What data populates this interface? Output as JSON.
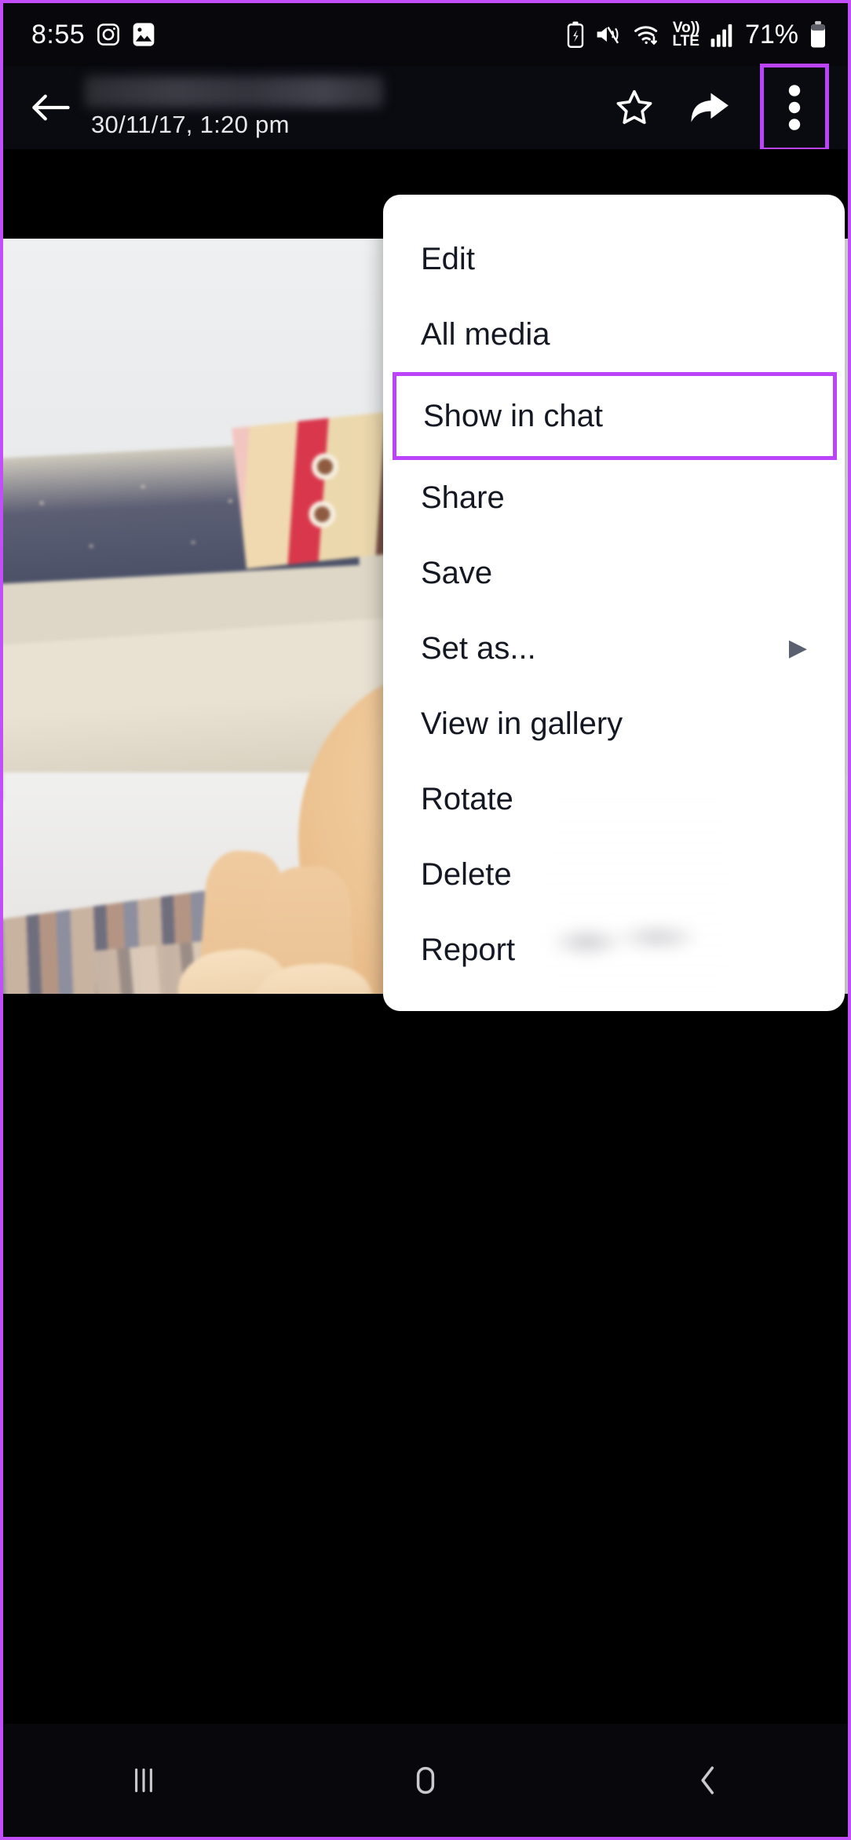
{
  "status_bar": {
    "clock": "8:55",
    "battery_percent": "71%",
    "left_icons": [
      "instagram-icon",
      "photos-icon"
    ],
    "right_icons": [
      "battery-saver-icon",
      "mute-vibrate-icon",
      "wifi-icon",
      "volte-icon",
      "signal-bars-icon",
      "battery-icon"
    ],
    "volte_label_top": "Vo)",
    "volte_label_bottom": "LTE"
  },
  "toolbar": {
    "back_icon": "arrow-left-icon",
    "contact_name": "",
    "timestamp": "30/11/17, 1:20 pm",
    "star_icon": "star-outline-icon",
    "forward_icon": "forward-arrow-icon",
    "overflow_icon": "three-dot-menu-icon"
  },
  "overflow_menu": {
    "items": [
      {
        "label": "Edit",
        "has_submenu": false,
        "highlighted": false
      },
      {
        "label": "All media",
        "has_submenu": false,
        "highlighted": false
      },
      {
        "label": "Show in chat",
        "has_submenu": false,
        "highlighted": true
      },
      {
        "label": "Share",
        "has_submenu": false,
        "highlighted": false
      },
      {
        "label": "Save",
        "has_submenu": false,
        "highlighted": false
      },
      {
        "label": "Set as...",
        "has_submenu": true,
        "highlighted": false
      },
      {
        "label": "View in gallery",
        "has_submenu": false,
        "highlighted": false
      },
      {
        "label": "Rotate",
        "has_submenu": false,
        "highlighted": false
      },
      {
        "label": "Delete",
        "has_submenu": false,
        "highlighted": false
      },
      {
        "label": "Report",
        "has_submenu": false,
        "highlighted": false
      }
    ],
    "submenu_arrow": "▶"
  },
  "nav_bar": {
    "recents_icon": "recents-icon",
    "home_icon": "home-icon",
    "back_icon": "back-chevron-icon"
  },
  "colors": {
    "highlight": "#bb44fb",
    "status_bar_bg": "#07070c",
    "toolbar_bg": "#0a0a11",
    "menu_bg": "#ffffff",
    "menu_text": "#141822"
  }
}
